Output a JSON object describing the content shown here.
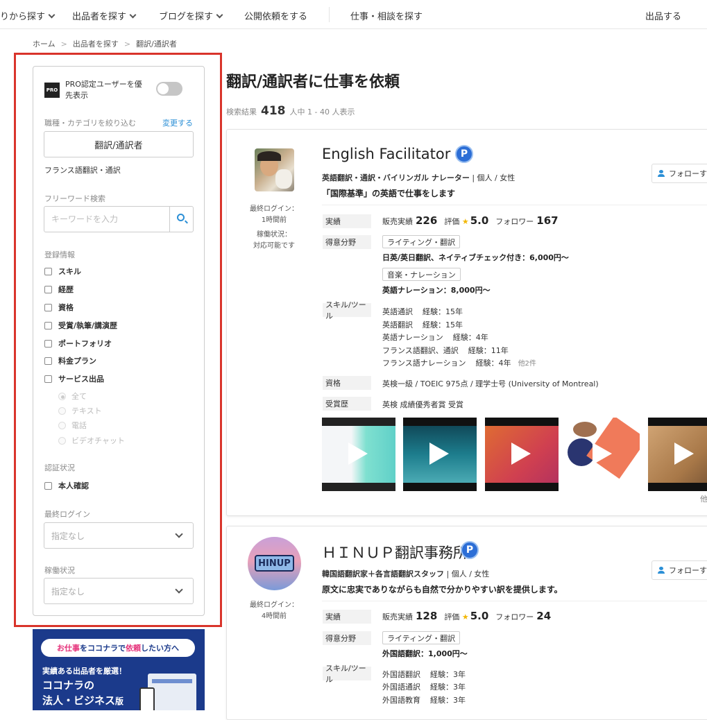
{
  "nav": {
    "items": [
      "りから探す",
      "出品者を探す",
      "ブログを探す",
      "公開依頼をする",
      "仕事・相談を探す",
      "出品する"
    ]
  },
  "breadcrumb": [
    "ホーム",
    "出品者を探す",
    "翻訳/通訳者"
  ],
  "sidebar": {
    "pro_label": "PRO認定ユーザーを優先表示",
    "pro_badge": "PRO",
    "category_label": "職種・カテゴリを絞り込む",
    "change_link": "変更する",
    "category_value": "翻訳/通訳者",
    "sub_category": "フランス語翻訳・通訳",
    "keyword_label": "フリーワード検索",
    "keyword_placeholder": "キーワードを入力",
    "registration_label": "登録情報",
    "registration_items": [
      "スキル",
      "経歴",
      "資格",
      "受賞/執筆/講演歴",
      "ポートフォリオ",
      "料金プラン",
      "サービス出品"
    ],
    "service_types": [
      "全て",
      "テキスト",
      "電話",
      "ビデオチャット"
    ],
    "auth_label": "認証状況",
    "auth_item": "本人確認",
    "last_login_label": "最終ログイン",
    "last_login_value": "指定なし",
    "status_label": "稼働状況",
    "status_value": "指定なし"
  },
  "banner": {
    "pill_a": "お仕事",
    "pill_b": "をココナラで",
    "pill_c": "依頼",
    "pill_d": "したい方へ",
    "line1": "実績ある出品者を厳選！",
    "line2": "ココナラの",
    "line3": "法人・ビジネス",
    "line3_small": "版"
  },
  "main": {
    "title": "翻訳/通訳者に仕事を依頼",
    "result_prefix": "検索結果",
    "result_count": "418",
    "result_suffix": "人中 1 - 40 人表示"
  },
  "cards": [
    {
      "name": "English Facilitator",
      "badge": "P",
      "tagline": "英語翻訳・通訳・バイリンガル ナレーター",
      "tagline_rest": " | 個人 / 女性",
      "catch": "「国際基準」の英語で仕事をします",
      "follow": "フォローする",
      "last_login_label": "最終ログイン：",
      "last_login": "1時間前",
      "status_label": "稼働状況：",
      "status": "対応可能です",
      "stats_label": "実績",
      "sales_label": "販売実績",
      "sales": "226",
      "rating_label": "評価",
      "rating": "5.0",
      "followers_label": "フォロワー",
      "followers": "167",
      "specialty_label": "得意分野",
      "specialties": [
        {
          "tag": "ライティング・翻訳",
          "detail": "日英/英日翻訳、ネイティブチェック付き：6,000円〜"
        },
        {
          "tag": "音楽・ナレーション",
          "detail": "英語ナレーション：8,000円〜"
        }
      ],
      "skills_label": "スキル/ツール",
      "skills": [
        {
          "name": "英語通訳",
          "exp": "経験：15年"
        },
        {
          "name": "英語翻訳",
          "exp": "経験：15年"
        },
        {
          "name": "英語ナレーション",
          "exp": "経験：4年"
        },
        {
          "name": "フランス語翻訳、通訳",
          "exp": "経験：11年"
        },
        {
          "name": "フランス語ナレーション",
          "exp": "経験：4年"
        }
      ],
      "skills_more": "他2件",
      "qual_label": "資格",
      "qual": "英検一級 / TOEIC 975点 / 理学士号 (University of Montreal)",
      "award_label": "受賞歴",
      "award": "英検 成績優秀者賞 受賞",
      "thumbs_more": "他"
    },
    {
      "name": "ＨＩＮＵＰ翻訳事務所",
      "badge": "P",
      "avatar_text": "HINUP",
      "tagline": "韓国語翻訳家＋各言語翻訳スタッフ",
      "tagline_rest": " | 個人 / 女性",
      "catch": "原文に忠実でありながらも自然で分かりやすい訳を提供します。",
      "follow": "フォローする",
      "last_login_label": "最終ログイン：",
      "last_login": "4時間前",
      "stats_label": "実績",
      "sales_label": "販売実績",
      "sales": "128",
      "rating_label": "評価",
      "rating": "5.0",
      "followers_label": "フォロワー",
      "followers": "24",
      "specialty_label": "得意分野",
      "specialties": [
        {
          "tag": "ライティング・翻訳",
          "detail": "外国語翻訳：1,000円〜"
        }
      ],
      "skills_label": "スキル/ツール",
      "skills": [
        {
          "name": "外国語翻訳",
          "exp": "経験：3年"
        },
        {
          "name": "外国語通訳",
          "exp": "経験：3年"
        },
        {
          "name": "外国語教育",
          "exp": "経験：3年"
        }
      ]
    }
  ]
}
